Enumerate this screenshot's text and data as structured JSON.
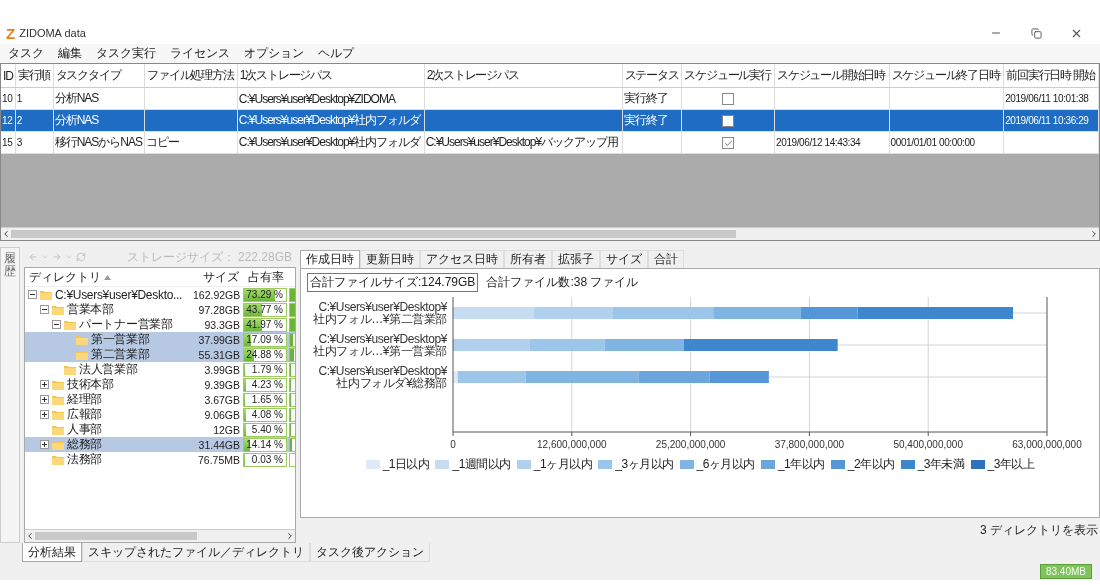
{
  "window": {
    "logo": "Z",
    "title": "ZIDOMA data"
  },
  "menu": [
    "タスク",
    "編集",
    "タスク実行",
    "ライセンス",
    "オプション",
    "ヘルプ"
  ],
  "tasks": {
    "columns": [
      "ID",
      "実行順",
      "タスクタイプ",
      "ファイル処理方法",
      "1次ストレージパス",
      "2次ストレージパス",
      "ステータス",
      "スケジュール実行",
      "スケジュール開始日時",
      "スケジュール終了日時",
      "前回実行日時 開始"
    ],
    "rows": [
      {
        "id": "10",
        "order": "1",
        "task_type": "分析NAS",
        "primary_path": "C:¥Users¥user¥Desktop¥ZIDOMA",
        "status": "実行終了",
        "scheduled": false,
        "last_run": "2019/06/11 10:01:38",
        "selected": false
      },
      {
        "id": "12",
        "order": "2",
        "task_type": "分析NAS",
        "primary_path": "C:¥Users¥user¥Desktop¥社内フォルダ",
        "status": "実行終了",
        "scheduled": false,
        "last_run": "2019/06/11 10:36:29",
        "selected": true
      },
      {
        "id": "15",
        "order": "3",
        "task_type": "移行NASからNAS",
        "file_method": "コピー",
        "primary_path": "C:¥Users¥user¥Desktop¥社内フォルダ",
        "secondary_path": "C:¥Users¥user¥Desktop¥バックアップ用",
        "scheduled": true,
        "start": "2019/06/12 14:43:34",
        "end": "0001/01/01 00:00:00",
        "selected": false
      }
    ]
  },
  "history_tab": {
    "label": "履歴"
  },
  "tree_panel": {
    "storage": "ストレージサイズ： 222.28GB",
    "columns": [
      "ディレクトリ",
      "サイズ",
      "占有率"
    ],
    "items": [
      {
        "name": "C:¥Users¥user¥Deskto...",
        "size": "162.92GB",
        "percent": "73.29 %",
        "level": 0.733,
        "expanded": true,
        "selected": false,
        "children": [
          {
            "name": "営業本部",
            "size": "97.28GB",
            "percent": "43.77 %",
            "level": 0.438,
            "expanded": true,
            "selected": false,
            "children": [
              {
                "name": "パートナー営業部",
                "size": "93.3GB",
                "percent": "41.97 %",
                "level": 0.42,
                "expanded": true,
                "selected": false,
                "children": [
                  {
                    "name": "第一営業部",
                    "size": "37.99GB",
                    "percent": "17.09 %",
                    "level": 0.171,
                    "selected": true
                  },
                  {
                    "name": "第二営業部",
                    "size": "55.31GB",
                    "percent": "24.88 %",
                    "level": 0.249,
                    "selected": true
                  }
                ]
              },
              {
                "name": "法人営業部",
                "size": "3.99GB",
                "percent": "1.79 %",
                "level": 0.018,
                "selected": false
              }
            ]
          },
          {
            "name": "技術本部",
            "size": "9.39GB",
            "percent": "4.23 %",
            "level": 0.042,
            "expanded": false,
            "selected": false
          },
          {
            "name": "経理部",
            "size": "3.67GB",
            "percent": "1.65 %",
            "level": 0.017,
            "expanded": false,
            "selected": false
          },
          {
            "name": "広報部",
            "size": "9.06GB",
            "percent": "4.08 %",
            "level": 0.041,
            "expanded": false,
            "selected": false
          },
          {
            "name": "人事部",
            "size": "12GB",
            "percent": "5.40 %",
            "level": 0.054,
            "selected": false
          },
          {
            "name": "総務部",
            "size": "31.44GB",
            "percent": "14.14 %",
            "level": 0.141,
            "expanded": false,
            "selected": true
          },
          {
            "name": "法務部",
            "size": "76.75MB",
            "percent": "0.03 %",
            "level": 0.0003,
            "selected": false
          }
        ]
      }
    ],
    "tabs": [
      {
        "label": "分析結果",
        "selected": true
      },
      {
        "label": "スキップされたファイル／ディレクトリ",
        "selected": false
      },
      {
        "label": "タスク後アクション",
        "selected": false
      }
    ]
  },
  "chart_panel": {
    "tabs": [
      {
        "label": "作成日時",
        "selected": true
      },
      {
        "label": "更新日時",
        "selected": false
      },
      {
        "label": "アクセス日時",
        "selected": false
      },
      {
        "label": "所有者",
        "selected": false
      },
      {
        "label": "拡張子",
        "selected": false
      },
      {
        "label": "サイズ",
        "selected": false
      },
      {
        "label": "合計",
        "selected": false
      }
    ],
    "total_size": "合計ファイルサイズ:124.79GB",
    "total_count": "合計ファイル数:38 ファイル",
    "chart_data": {
      "type": "bar",
      "orientation": "horizontal",
      "stacked": true,
      "grid": true,
      "categories": [
        "C:¥Users¥user¥Desktop¥\n社内フォル…¥第二営業部",
        "C:¥Users¥user¥Desktop¥\n社内フォル…¥第一営業部",
        "C:¥Users¥user¥Desktop¥\n社内フォルダ¥総務部"
      ],
      "xlim": [
        0,
        63000000000
      ],
      "xticks": [
        {
          "value": 0,
          "label": "0"
        },
        {
          "value": 12600000000,
          "label": "12,600,000,000"
        },
        {
          "value": 25200000000,
          "label": "25,200,000,000"
        },
        {
          "value": 37800000000,
          "label": "37,800,000,000"
        },
        {
          "value": 50400000000,
          "label": "50,400,000,000"
        },
        {
          "value": 63000000000,
          "label": "63,000,000,000"
        }
      ],
      "series": [
        {
          "name": "_1日以内",
          "color": "#deebf7",
          "values": [
            0,
            0,
            500000000
          ]
        },
        {
          "name": "_1週間以内",
          "color": "#c6dcf0",
          "values": [
            8600000000,
            0,
            0
          ]
        },
        {
          "name": "_1ヶ月以内",
          "color": "#b0d0ee",
          "values": [
            8300000000,
            8100000000,
            0
          ]
        },
        {
          "name": "_3ヶ月以内",
          "color": "#9cc5ea",
          "values": [
            10700000000,
            8000000000,
            7200000000
          ]
        },
        {
          "name": "_6ヶ月以内",
          "color": "#80b4e3",
          "values": [
            9300000000,
            8400000000,
            12000000000
          ]
        },
        {
          "name": "_1年以内",
          "color": "#6aa6dc",
          "values": [
            0,
            0,
            7500000000
          ]
        },
        {
          "name": "_2年以内",
          "color": "#5597d6",
          "values": [
            6000000000,
            0,
            6300000000
          ]
        },
        {
          "name": "_3年未満",
          "color": "#3f87cc",
          "values": [
            16500000000,
            16300000000,
            0
          ]
        },
        {
          "name": "_3年以上",
          "color": "#2d73bb",
          "values": [
            0,
            0,
            0
          ]
        }
      ]
    },
    "footer": "3 ディレクトリを表示"
  },
  "status_bar": {
    "memory": "83.40MB"
  }
}
